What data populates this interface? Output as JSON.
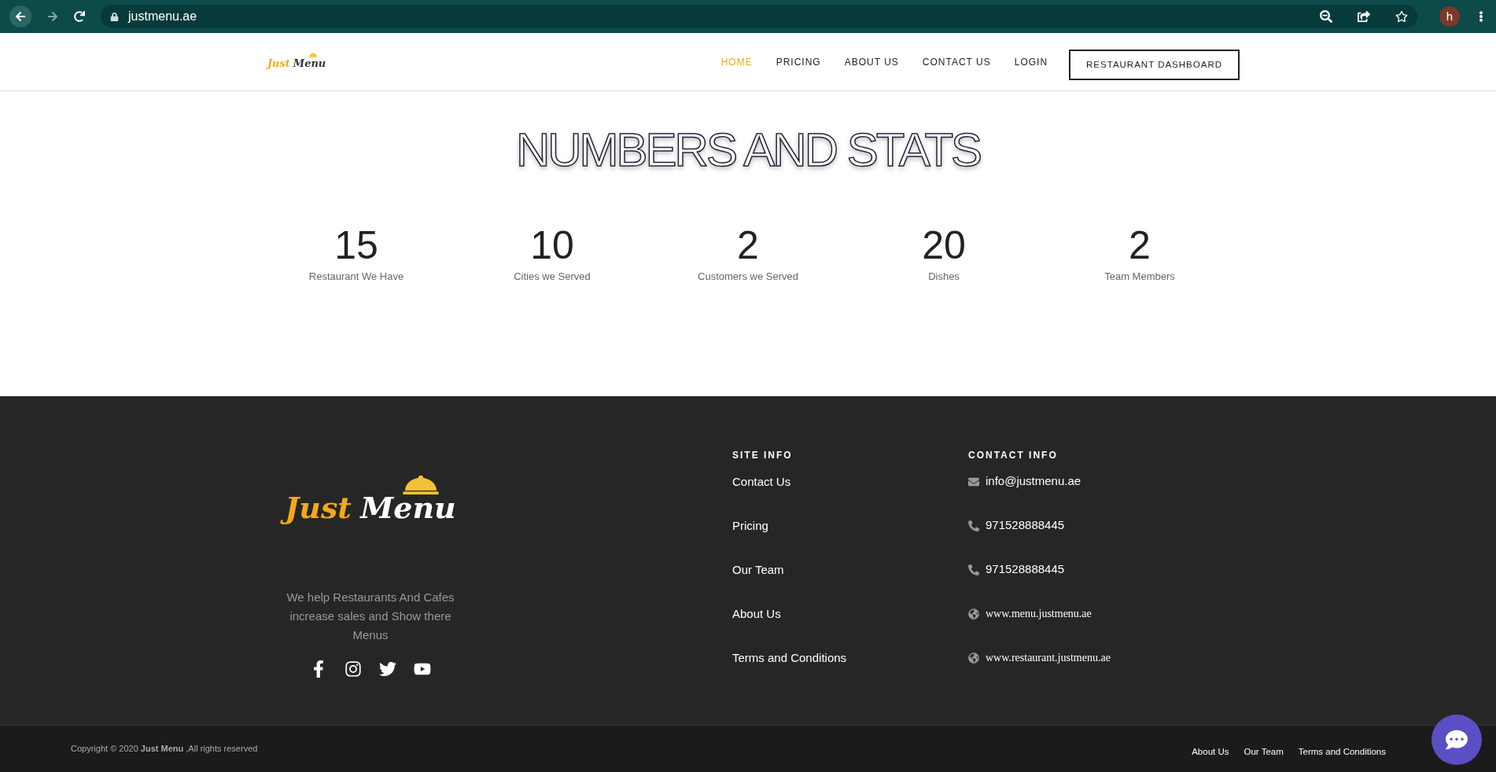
{
  "browser": {
    "url": "justmenu.ae",
    "profile_initial": "h"
  },
  "header": {
    "logo": {
      "word_1": "Just",
      "word_2": "Menu"
    },
    "nav": [
      {
        "label": "HOME",
        "selected": true
      },
      {
        "label": "PRICING",
        "selected": false
      },
      {
        "label": "ABOUT US",
        "selected": false
      },
      {
        "label": "CONTACT US",
        "selected": false
      },
      {
        "label": "LOGIN",
        "selected": false
      }
    ],
    "cta": "RESTAURANT DASHBOARD"
  },
  "stats": {
    "title": "NUMBERS AND STATS",
    "items": [
      {
        "value": "15",
        "label": "Restaurant We Have"
      },
      {
        "value": "10",
        "label": "Cities we Served"
      },
      {
        "value": "2",
        "label": "Customers we Served"
      },
      {
        "value": "20",
        "label": "Dishes"
      },
      {
        "value": "2",
        "label": "Team Members"
      }
    ]
  },
  "footer": {
    "logo": {
      "word_1": "Just",
      "word_2": "Menu"
    },
    "tagline": "We help Restaurants And Cafes increase sales and Show there Menus",
    "social": [
      {
        "kind": "facebook"
      },
      {
        "kind": "instagram"
      },
      {
        "kind": "twitter"
      },
      {
        "kind": "youtube"
      }
    ],
    "site_info": {
      "heading": "SITE INFO",
      "links": [
        "Contact Us",
        "Pricing",
        "Our Team",
        "About Us",
        "Terms and Conditions"
      ]
    },
    "contact_info": {
      "heading": "CONTACT INFO",
      "items": [
        {
          "kind": "email",
          "text": "info@justmenu.ae"
        },
        {
          "kind": "phone",
          "text": "971528888445"
        },
        {
          "kind": "phone",
          "text": "971528888445"
        },
        {
          "kind": "web",
          "text": "www.menu.justmenu.ae"
        },
        {
          "kind": "web",
          "text": "www.restaurant.justmenu.ae"
        }
      ]
    }
  },
  "bottom_bar": {
    "copyright": "Copyright © 2020 **Just Menu** ,All rights reserved",
    "links": [
      "About Us",
      "Our Team",
      "Terms and Conditions"
    ]
  }
}
